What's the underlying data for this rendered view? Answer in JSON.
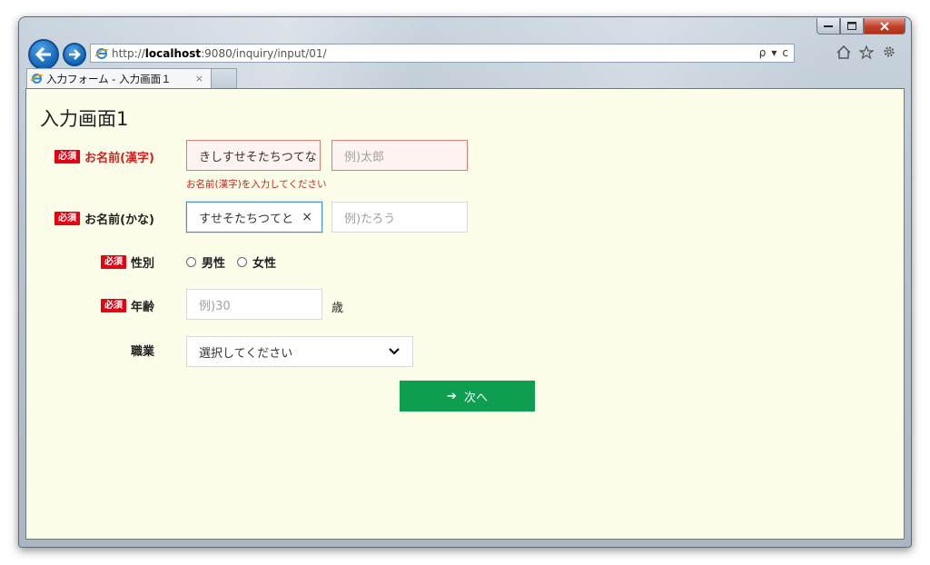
{
  "browser": {
    "url_prefix": "http://",
    "url_host": "localhost",
    "url_rest": ":9080/inquiry/input/01/",
    "search_glyph": "ρ",
    "dropdown_glyph": "▾",
    "refresh_glyph": "ⅽ",
    "tab_title": "入力フォーム - 入力画面１",
    "tab_close": "×",
    "icons": [
      "back-arrow-icon",
      "forward-arrow-icon",
      "ie-logo-icon",
      "search-icon",
      "refresh-icon",
      "home-icon",
      "star-icon",
      "gear-icon"
    ]
  },
  "page": {
    "title": "入力画面1",
    "required_badge": "必須",
    "name_kanji": {
      "label": "お名前(漢字)",
      "last_value": "きしすせそたちつてな",
      "first_placeholder": "例)太郎",
      "error": "お名前(漢字)を入力してください"
    },
    "name_kana": {
      "label": "お名前(かな)",
      "last_value": "すせそたちつてと",
      "clear_glyph": "×",
      "first_placeholder": "例)たろう"
    },
    "gender": {
      "label": "性別",
      "options": [
        "男性",
        "女性"
      ]
    },
    "age": {
      "label": "年齢",
      "placeholder": "例)30",
      "unit": "歳"
    },
    "occupation": {
      "label": "職業",
      "selected": "選択してください"
    },
    "next_button": {
      "icon": "➔",
      "label": "次へ"
    }
  },
  "colors": {
    "accent_green": "#0d9f4f",
    "required_red": "#e60012",
    "error_text": "#c0261e",
    "page_bg": "#fdfee9"
  }
}
